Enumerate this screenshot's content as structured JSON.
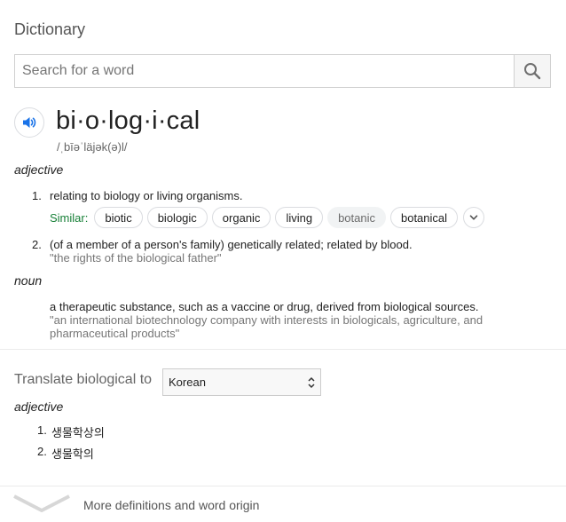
{
  "title": "Dictionary",
  "search": {
    "placeholder": "Search for a word",
    "value": ""
  },
  "entry": {
    "word": "bi·o·log·i·cal",
    "phonetic": "/ˌbīəˈläjək(ə)l/",
    "adjective": {
      "pos": "adjective",
      "senses": [
        {
          "num": "1.",
          "definition": "relating to biology or living organisms."
        },
        {
          "num": "2.",
          "definition": "(of a member of a person's family) genetically related; related by blood.",
          "example": "\"the rights of the biological father\""
        }
      ],
      "similar_label": "Similar:",
      "similar": [
        "biotic",
        "biologic",
        "organic",
        "living",
        "botanic",
        "botanical"
      ]
    },
    "noun": {
      "pos": "noun",
      "definition": "a therapeutic substance, such as a vaccine or drug, derived from biological sources.",
      "example": "\"an international biotechnology company with interests in biologicals, agriculture, and pharmaceutical products\""
    }
  },
  "translate": {
    "label": "Translate biological to",
    "language": "Korean",
    "pos": "adjective",
    "items": [
      {
        "num": "1.",
        "text": "생물학상의"
      },
      {
        "num": "2.",
        "text": "생물학의"
      }
    ]
  },
  "footer": {
    "more_label": "More definitions and word origin"
  },
  "icons": {
    "search": "search-icon",
    "audio": "speaker-icon",
    "expand": "chevron-down-icon",
    "select": "up-down-arrows-icon",
    "more": "chevron-down-icon"
  },
  "colors": {
    "accent": "#1a73e8",
    "similar_label": "#188038",
    "example_text": "#767676"
  }
}
